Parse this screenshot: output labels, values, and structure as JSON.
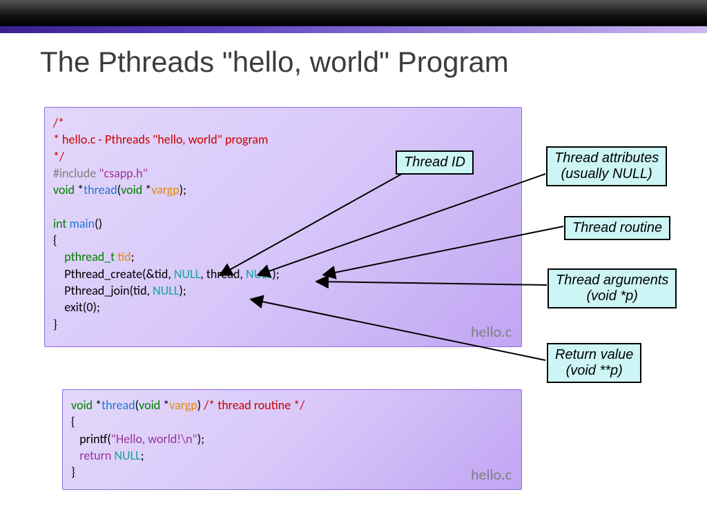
{
  "title": "The Pthreads \"hello, world\" Program",
  "box1_filename": "hello.c",
  "box2_filename": "hello.c",
  "code1": {
    "c1": "/*",
    "c2": " * hello.c - Pthreads \"hello, world\" program",
    "c3": " */",
    "include": "#include ",
    "include_file": "\"csapp.h\"",
    "void": "void ",
    "star": "*",
    "thread": "thread",
    "paren_open": "(",
    "void2": "void ",
    "vargp": "vargp",
    "paren_close_semi": ");",
    "int": "int ",
    "main": "main",
    "parens_empty": "()",
    "brace_open": "{",
    "pthread_t": "    pthread_t ",
    "tid": "tid",
    "semi": ";",
    "pcreate": "    Pthread_create(&tid, ",
    "null1": "NULL",
    "comma_thread": ", thread, ",
    "null2": "NULL",
    "close_call1": ");",
    "pjoin": "    Pthread_join(tid, ",
    "null3": "NULL",
    "close_call2": ");",
    "exit": "    exit(0);",
    "brace_close": "}"
  },
  "code2": {
    "void": "void ",
    "star": "*",
    "thread": "thread",
    "paren_open": "(",
    "void2": "void ",
    "vargp": "vargp",
    "paren_close": ") ",
    "comment": "/* thread routine */",
    "brace_open": "{",
    "printf": "   printf(",
    "hello_str": "\"Hello, world!\\n\"",
    "close_printf": ");",
    "return": "   return ",
    "null": "NULL",
    "semi": ";",
    "brace_close": "}"
  },
  "callouts": {
    "thread_id": "Thread ID",
    "thread_attrs_l1": "Thread attributes",
    "thread_attrs_l2": "(usually NULL)",
    "thread_routine": "Thread routine",
    "thread_args_l1": "Thread arguments",
    "thread_args_l2": "(void *p)",
    "return_val_l1": "Return value",
    "return_val_l2": "(void **p)"
  }
}
